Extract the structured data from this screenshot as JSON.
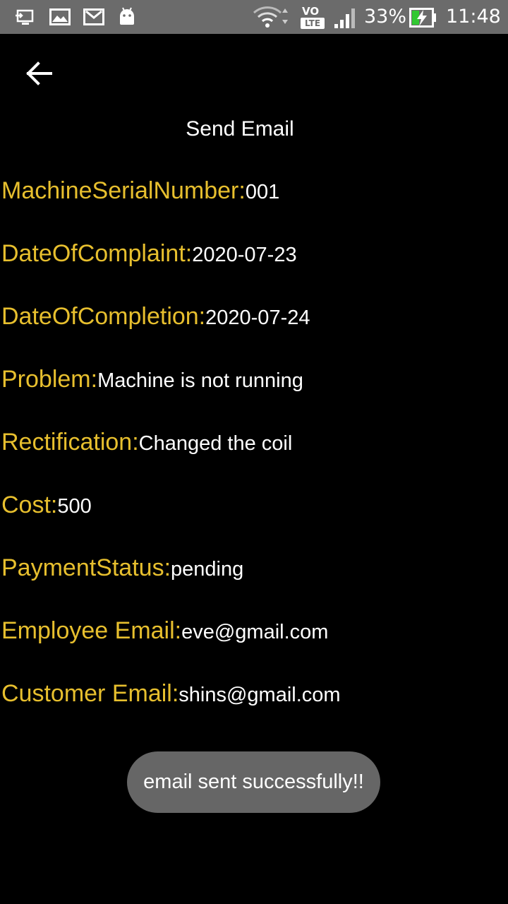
{
  "status_bar": {
    "battery_percent": "33%",
    "time": "11:48",
    "network_label_top": "VO",
    "network_label_bottom": "LTE",
    "icons": [
      "screen-cast-icon",
      "image-icon",
      "gmail-icon",
      "android-icon",
      "wifi-icon",
      "volte-icon",
      "signal-icon",
      "battery-charging-icon"
    ]
  },
  "header": {
    "title": "Send Email"
  },
  "details": [
    {
      "label": "MachineSerialNumber:",
      "value": "001"
    },
    {
      "label": "DateOfComplaint:",
      "value": "2020-07-23"
    },
    {
      "label": "DateOfCompletion:",
      "value": "2020-07-24"
    },
    {
      "label": "Problem:",
      "value": "Machine is not running"
    },
    {
      "label": "Rectification:",
      "value": "Changed the coil"
    },
    {
      "label": "Cost:",
      "value": "500"
    },
    {
      "label": "PaymentStatus:",
      "value": "pending"
    },
    {
      "label": "Employee Email:",
      "value": "eve@gmail.com"
    },
    {
      "label": "Customer Email:",
      "value": "shins@gmail.com"
    }
  ],
  "toast": {
    "message": "email sent successfully!!"
  },
  "colors": {
    "background": "#000000",
    "status_bar": "#6b6b6b",
    "label": "#e7bf2e",
    "value": "#ffffff",
    "toast_bg": "#666666"
  }
}
